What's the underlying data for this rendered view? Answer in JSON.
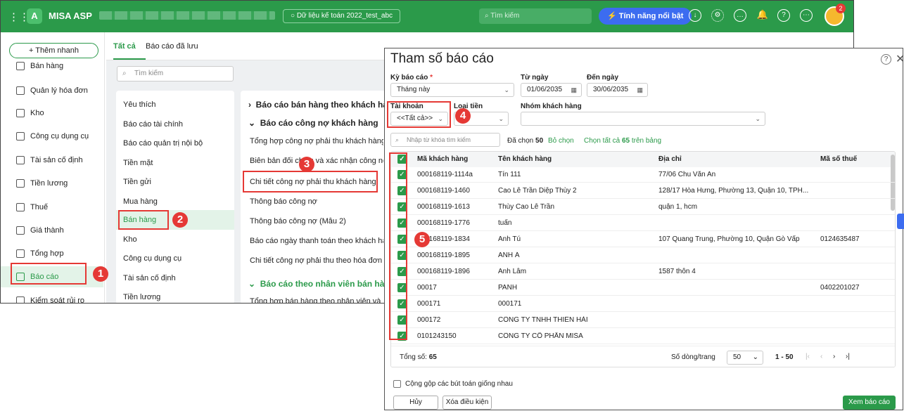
{
  "app": {
    "name": "MISA ASP",
    "data_label": "Dữ liệu kế toán 2022_test_abc",
    "search_placeholder": "Tìm kiếm",
    "feature_label": "Tính năng nổi bật",
    "notification_count": "2"
  },
  "sidebar": {
    "add_label": "+ Thêm nhanh",
    "items": [
      "Bán hàng",
      "Quản lý hóa đơn",
      "Kho",
      "Công cụ dụng cụ",
      "Tài sản cố định",
      "Tiền lương",
      "Thuế",
      "Giá thành",
      "Tổng hợp",
      "Báo cáo",
      "Kiểm soát rủi ro"
    ]
  },
  "tabs": [
    "Tất cả",
    "Báo cáo đã lưu"
  ],
  "search_placeholder": "Tìm kiếm",
  "categories": [
    "Yêu thích",
    "Báo cáo tài chính",
    "Báo cáo quản trị nội bộ",
    "Tiền mặt",
    "Tiền gửi",
    "Mua hàng",
    "Bán hàng",
    "Kho",
    "Công cụ dụng cụ",
    "Tài sản cố định",
    "Tiền lương"
  ],
  "reports": {
    "group1": "Báo cáo bán hàng theo khách hàng",
    "group2": "Báo cáo công nợ khách hàng",
    "items": [
      "Tổng hợp công nợ phải thu khách hàng",
      "Biên bản đối chiếu và xác nhận công nợ",
      "Chi tiết công nợ phải thu khách hàng",
      "Thông báo công nợ",
      "Thông báo công nợ (Mẫu 2)",
      "Báo cáo ngày thanh toán theo khách hàng",
      "Chi tiết công nợ phải thu theo hóa đơn"
    ],
    "group3": "Báo cáo theo nhân viên bán hàng",
    "item_last": "Tổng hợp bán hàng theo nhân viên và khách hàng"
  },
  "steps": [
    "1",
    "2",
    "3",
    "4",
    "5"
  ],
  "dialog": {
    "title": "Tham số báo cáo",
    "period_label": "Kỳ báo cáo",
    "period_value": "Tháng này",
    "from_label": "Từ ngày",
    "from_value": "01/06/2035",
    "to_label": "Đến ngày",
    "to_value": "30/06/2035",
    "account_label": "Tài khoản",
    "account_value": "<<Tất cả>>",
    "currency_label": "Loại tiền",
    "group_label": "Nhóm khách hàng",
    "search_placeholder": "Nhập từ khóa tìm kiếm",
    "selected_prefix": "Đã chọn",
    "selected_count": "50",
    "deselect": "Bỏ chọn",
    "select_all": "Chọn tất cả",
    "total_count": "65",
    "select_all_suffix": "trên bảng",
    "columns": [
      "Mã khách hàng",
      "Tên khách hàng",
      "Địa chỉ",
      "Mã số thuế"
    ],
    "rows": [
      [
        "000168119-1114a",
        "Tín 111",
        "77/06 Chu Văn An",
        ""
      ],
      [
        "000168119-1460",
        "Cao Lê Trần Diệp Thùy 2",
        "128/17 Hòa Hưng, Phường 13, Quận 10, TPH...",
        ""
      ],
      [
        "000168119-1613",
        "Thùy Cao Lê Trần",
        "quận 1, hcm",
        ""
      ],
      [
        "000168119-1776",
        "tuấn",
        "",
        ""
      ],
      [
        "000168119-1834",
        "Anh Tú",
        "107 Quang Trung, Phường 10, Quận Gò Vấp",
        "0124635487"
      ],
      [
        "000168119-1895",
        "ANH Á",
        "",
        ""
      ],
      [
        "000168119-1896",
        "Anh Lâm",
        "1587 thôn 4",
        ""
      ],
      [
        "00017",
        "PANH",
        "",
        "0402201027"
      ],
      [
        "000171",
        "000171",
        "",
        ""
      ],
      [
        "000172",
        "CÔNG TY TNHH THIÊN HẢI",
        "",
        ""
      ],
      [
        "0101243150",
        "CÔNG TY CỔ PHẦN MISA",
        "",
        ""
      ]
    ],
    "total_label": "Tổng số:",
    "total_value": "65",
    "rows_per_page_label": "Số dòng/trang",
    "rows_per_page": "50",
    "page_range": "1 - 50",
    "merge_label": "Cộng gộp các bút toán giống nhau",
    "cancel": "Hủy",
    "clear": "Xóa điều kiện",
    "view": "Xem báo cáo"
  },
  "colors": {
    "brand": "#2b9a4a",
    "accent": "#3c6cf0",
    "highlight": "#e53935"
  }
}
